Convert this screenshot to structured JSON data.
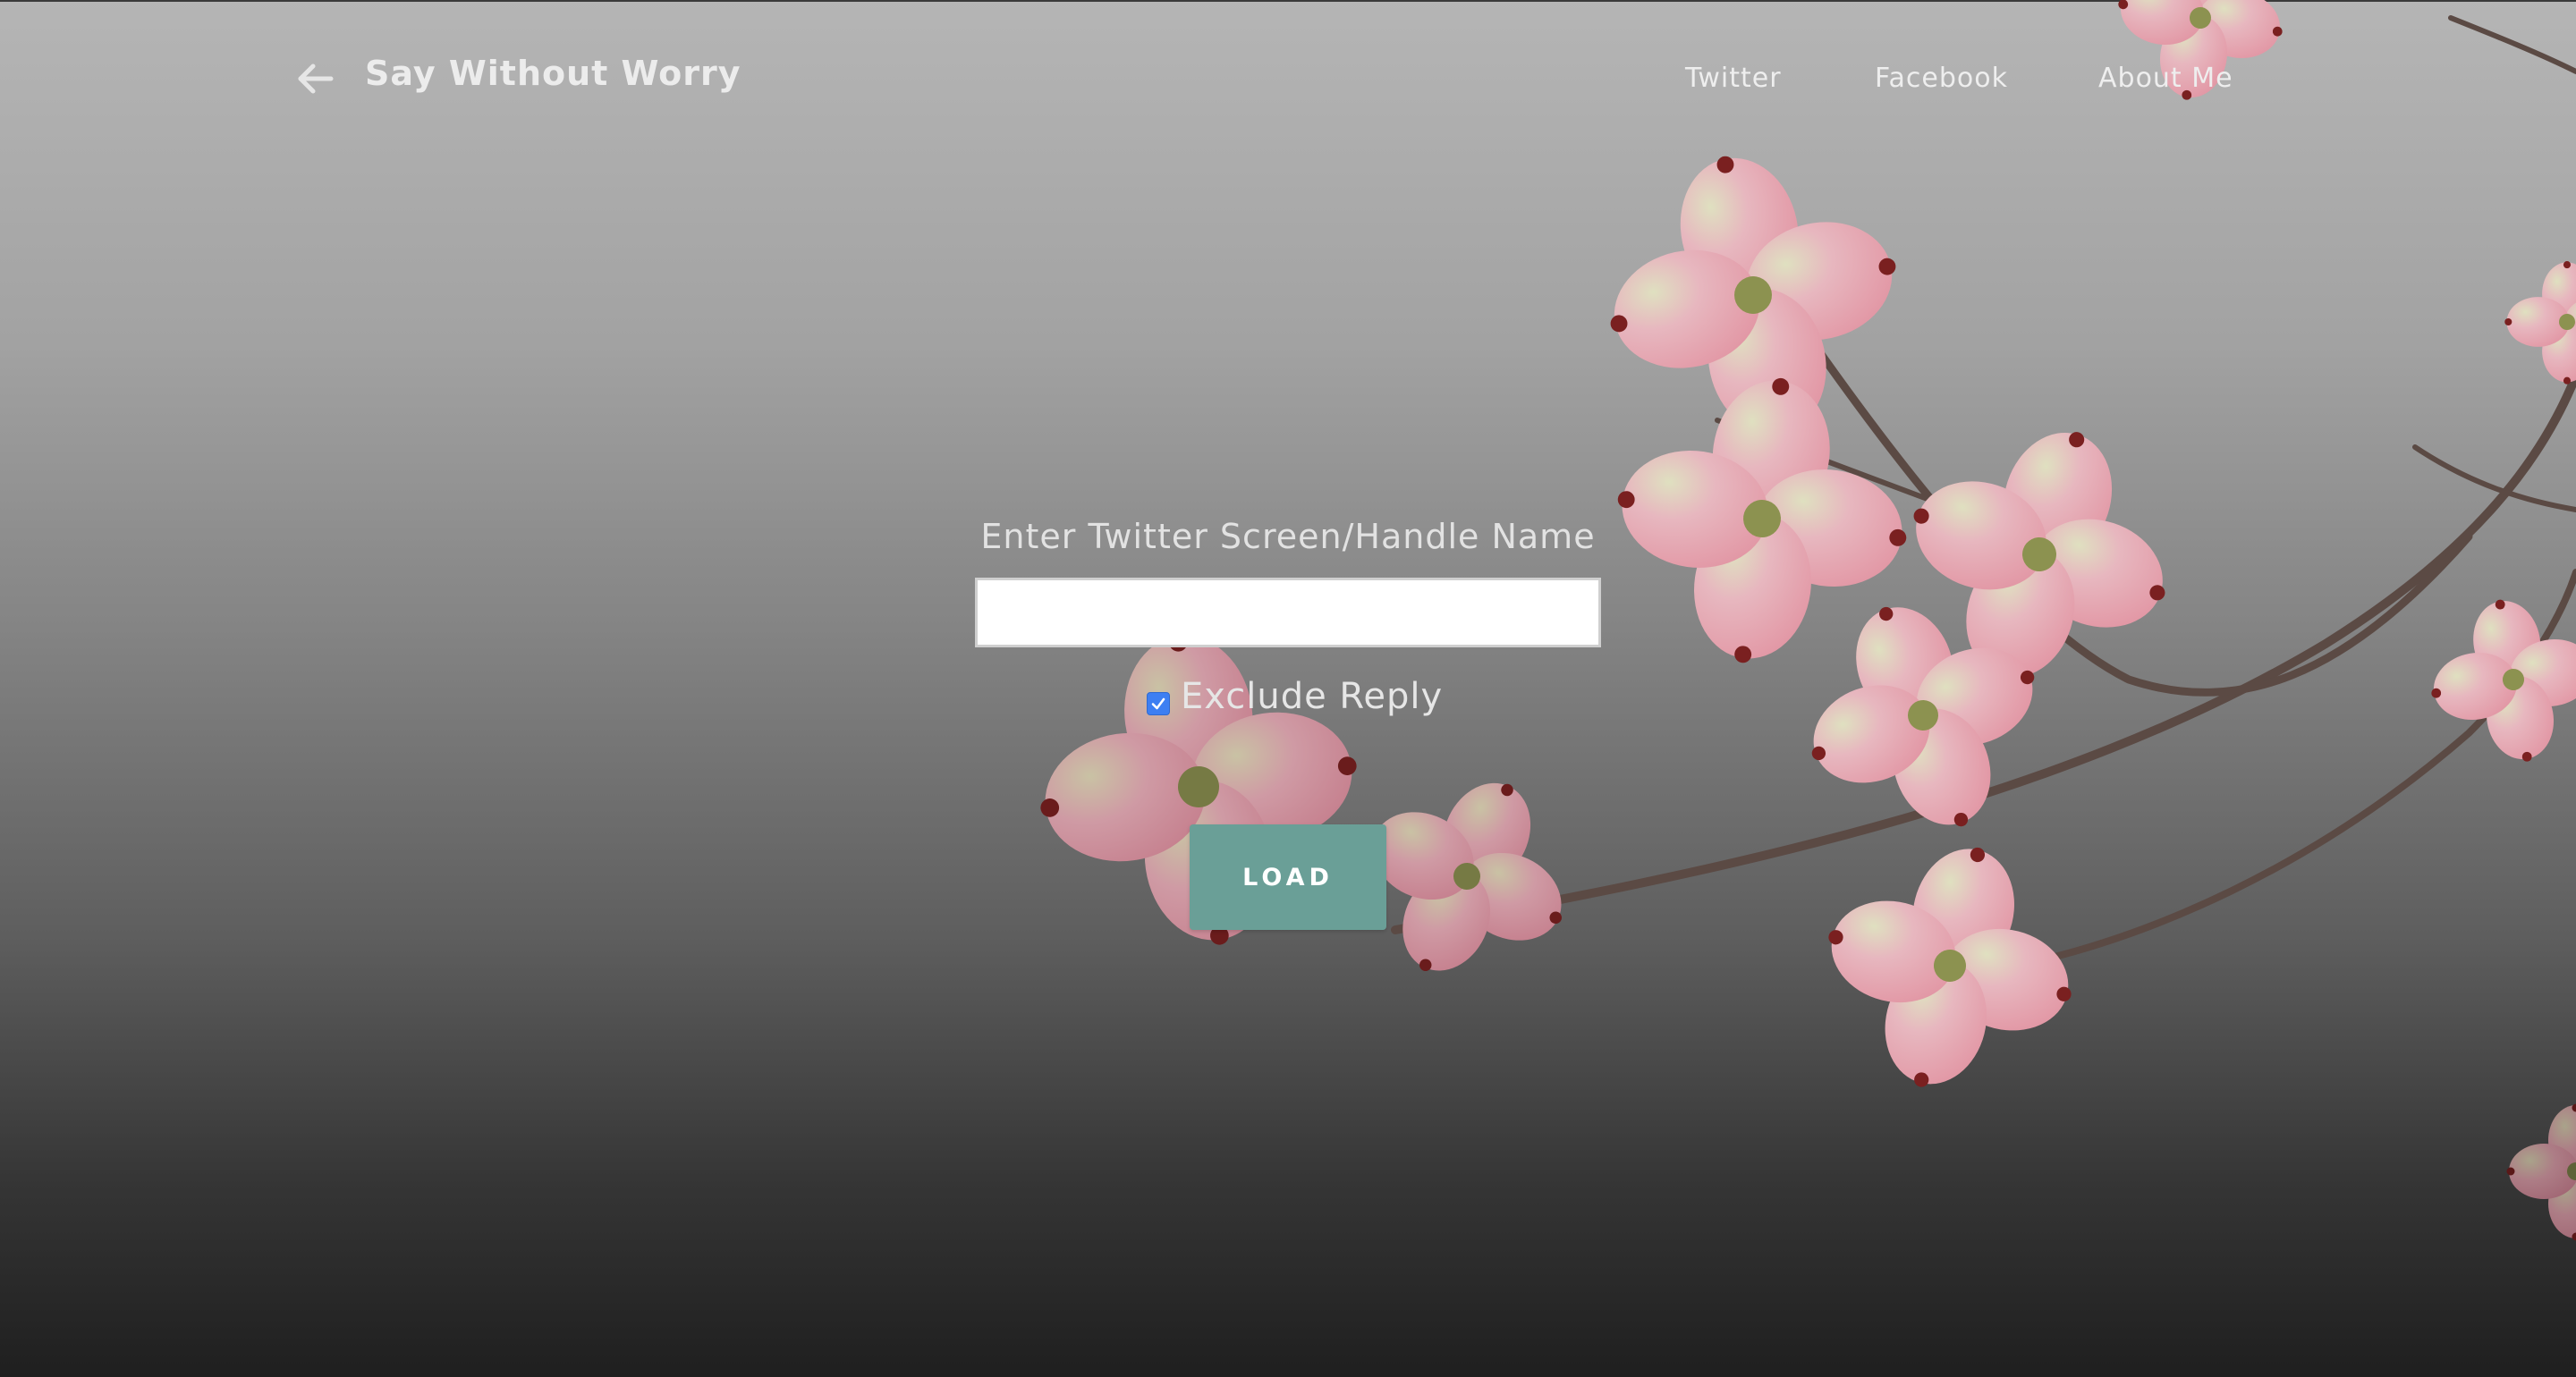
{
  "header": {
    "brand": "Say Without Worry",
    "nav": {
      "twitter": "Twitter",
      "facebook": "Facebook",
      "about": "About Me"
    }
  },
  "form": {
    "label": "Enter Twitter Screen/Handle Name",
    "input_value": "",
    "exclude_reply_label": "Exclude Reply",
    "exclude_reply_checked": true,
    "load_button": "LOAD"
  },
  "colors": {
    "button": "#6a9f97",
    "checkbox": "#3d7ff2",
    "flower_petal": "#e8a6b4",
    "flower_tip": "#7a2020"
  },
  "icons": {
    "back": "arrow-left-icon",
    "check": "checkmark-icon"
  }
}
